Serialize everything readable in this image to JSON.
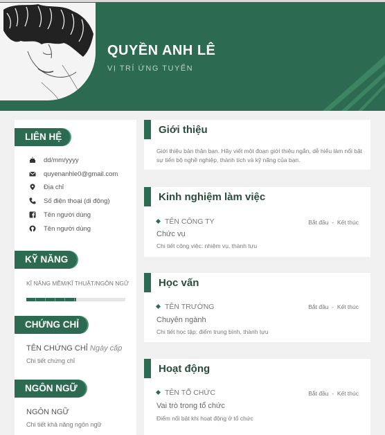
{
  "header": {
    "name": "QUYỀN ANH LÊ",
    "position": "VỊ TRÍ ỨNG TUYỂN"
  },
  "left": {
    "contact": {
      "title": "LIÊN HỆ",
      "items": [
        {
          "icon": "birthday-cake-icon",
          "text": "dd/mm/yyyy"
        },
        {
          "icon": "email-icon",
          "text": "quyenanhle0@gmail.com"
        },
        {
          "icon": "location-pin-icon",
          "text": "Địa chỉ"
        },
        {
          "icon": "phone-icon",
          "text": "Số điện thoại (di động)"
        },
        {
          "icon": "facebook-icon",
          "text": "Tên người dùng"
        },
        {
          "icon": "github-icon",
          "text": "Tên người dùng"
        }
      ]
    },
    "skills": {
      "title": "KỸ NĂNG",
      "label": "KĨ NĂNG MỀM/KĨ THUẬT/NGÔN NGỮ",
      "level": 0.5
    },
    "certificates": {
      "title": "CHỨNG CHỈ",
      "name": "TÊN CHỨNG CHỈ",
      "date": "Ngày cấp",
      "detail": "Chi tiết chứng chỉ"
    },
    "languages": {
      "title": "NGÔN NGỮ",
      "name": "NGÔN NGỮ",
      "detail": "Chi tiết khả năng ngôn ngữ"
    }
  },
  "right": {
    "intro": {
      "title": "Giới thiệu",
      "text": "Giới thiệu bản thân bạn. Hãy viết một đoạn giới thiệu ngắn, dễ hiểu làm nổi bật sự tiến bộ nghề nghiệp, thành tích và kỹ năng của bạn."
    },
    "experience": {
      "title": "Kinh nghiệm làm việc",
      "item": "TÊN CÔNG TY",
      "start": "Bắt đầu",
      "end": "Kết thúc",
      "role": "Chức vụ",
      "detail": "Chi tiết công việc: nhiệm vụ, thành tựu"
    },
    "education": {
      "title": "Học vấn",
      "item": "TÊN TRƯỜNG",
      "start": "Bắt đầu",
      "end": "Kết thúc",
      "role": "Chuyên ngành",
      "detail": "Chi tiết học tập: điểm trung bình, thành tựu"
    },
    "activities": {
      "title": "Hoạt động",
      "item": "TÊN TỔ CHỨC",
      "start": "Bắt đầu",
      "end": "Kết thúc",
      "role": "Vai trò trong tổ chức",
      "detail": "Điểm nổi bật khi hoạt động ở tổ chức"
    }
  },
  "colors": {
    "accent": "#2c6b51",
    "background": "#f0f0f0"
  }
}
